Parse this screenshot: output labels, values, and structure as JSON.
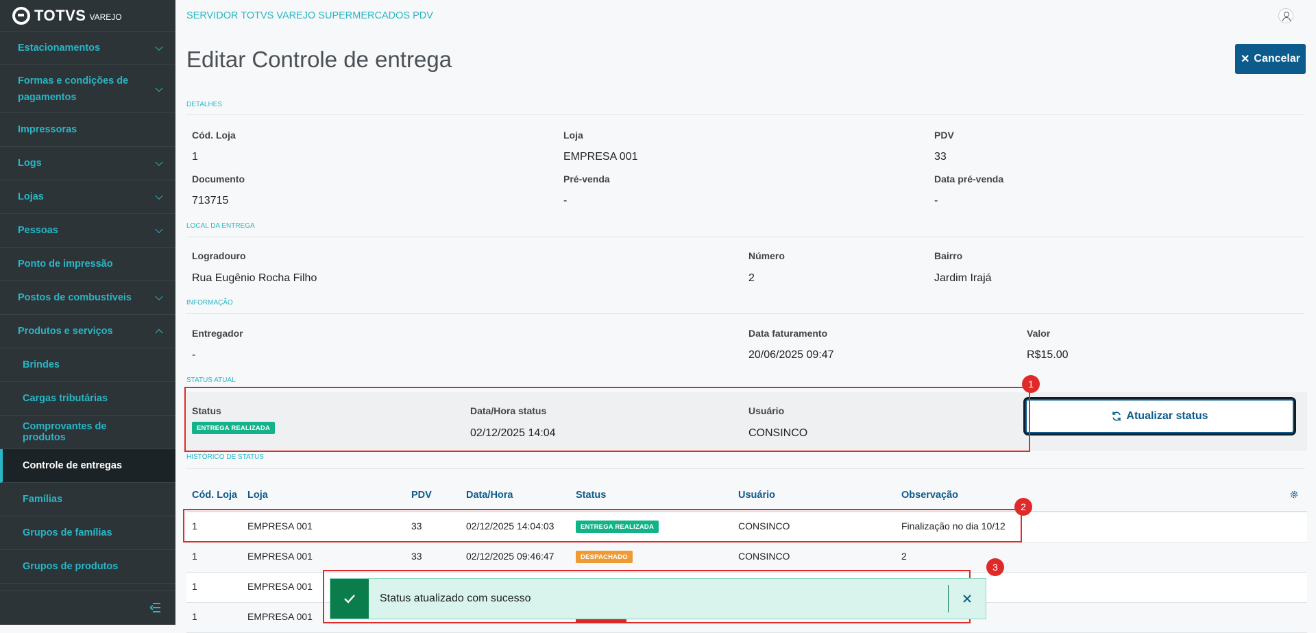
{
  "brand": {
    "name": "TOTVS",
    "sub": "VAREJO"
  },
  "sidebar": {
    "items": [
      {
        "label": "Estacionamentos",
        "chev": "down"
      },
      {
        "label": "Formas e condições de pagamentos",
        "chev": "down"
      },
      {
        "label": "Impressoras",
        "chev": ""
      },
      {
        "label": "Logs",
        "chev": "down"
      },
      {
        "label": "Lojas",
        "chev": "down"
      },
      {
        "label": "Pessoas",
        "chev": "down"
      },
      {
        "label": "Ponto de impressão",
        "chev": ""
      },
      {
        "label": "Postos de combustíveis",
        "chev": "down"
      },
      {
        "label": "Produtos e serviços",
        "chev": "up"
      },
      {
        "label": "Brindes",
        "child": true
      },
      {
        "label": "Cargas tributárias",
        "child": true
      },
      {
        "label": "Comprovantes de produtos",
        "child": true
      },
      {
        "label": "Controle de entregas",
        "child": true,
        "active": true
      },
      {
        "label": "Famílias",
        "child": true
      },
      {
        "label": "Grupos de famílias",
        "child": true
      },
      {
        "label": "Grupos de produtos",
        "child": true
      }
    ]
  },
  "header": {
    "app_title": "SERVIDOR TOTVS VAREJO SUPERMERCADOS PDV",
    "page_title": "Editar Controle de entrega",
    "cancel_label": "Cancelar"
  },
  "details": {
    "section": "DETALHES",
    "cod_loja_label": "Cód. Loja",
    "cod_loja": "1",
    "loja_label": "Loja",
    "loja": "EMPRESA 001",
    "pdv_label": "PDV",
    "pdv": "33",
    "documento_label": "Documento",
    "documento": "713715",
    "prevenda_label": "Pré-venda",
    "prevenda": "-",
    "data_prevenda_label": "Data pré-venda",
    "data_prevenda": "-"
  },
  "local": {
    "section": "LOCAL DA ENTREGA",
    "logradouro_label": "Logradouro",
    "logradouro": "Rua Eugênio Rocha Filho",
    "numero_label": "Número",
    "numero": "2",
    "bairro_label": "Bairro",
    "bairro": "Jardim Irajá"
  },
  "info": {
    "section": "INFORMAÇÃO",
    "entregador_label": "Entregador",
    "entregador": "-",
    "data_fat_label": "Data faturamento",
    "data_fat": "20/06/2025 09:47",
    "valor_label": "Valor",
    "valor": "R$15.00"
  },
  "status_atual": {
    "section": "STATUS ATUAL",
    "status_label": "Status",
    "status": "ENTREGA REALIZADA",
    "datahora_label": "Data/Hora status",
    "datahora": "02/12/2025 14:04",
    "usuario_label": "Usuário",
    "usuario": "CONSINCO",
    "update_label": "Atualizar status"
  },
  "historico": {
    "section": "HISTÓRICO DE STATUS",
    "columns": [
      "Cód. Loja",
      "Loja",
      "PDV",
      "Data/Hora",
      "Status",
      "Usuário",
      "Observação"
    ],
    "rows": [
      {
        "cod": "1",
        "loja": "EMPRESA 001",
        "pdv": "33",
        "datahora": "02/12/2025 14:04:03",
        "status": "ENTREGA REALIZADA",
        "status_color": "green",
        "usuario": "CONSINCO",
        "obs": "Finalização no dia 10/12"
      },
      {
        "cod": "1",
        "loja": "EMPRESA 001",
        "pdv": "33",
        "datahora": "02/12/2025 09:46:47",
        "status": "DESPACHADO",
        "status_color": "orange",
        "usuario": "CONSINCO",
        "obs": "2"
      },
      {
        "cod": "1",
        "loja": "EMPRESA 001",
        "pdv": "",
        "datahora": "",
        "status": "",
        "status_color": "",
        "usuario": "",
        "obs": ""
      },
      {
        "cod": "1",
        "loja": "EMPRESA 001",
        "pdv": "",
        "datahora": "",
        "status": "",
        "status_color": "red",
        "usuario": "",
        "obs": ""
      }
    ]
  },
  "toast": {
    "message": "Status atualizado com sucesso"
  },
  "annotations": [
    "1",
    "2",
    "3"
  ],
  "colors": {
    "accent": "#29b6c5",
    "primary": "#0c5b8c",
    "sidebar": "#2c3438",
    "success": "#13b38a",
    "annotation": "#e02a2a"
  }
}
